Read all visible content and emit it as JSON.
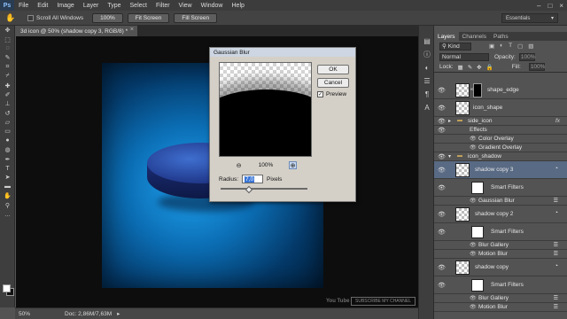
{
  "app": {
    "logo": "Ps"
  },
  "menu": [
    "File",
    "Edit",
    "Image",
    "Layer",
    "Type",
    "Select",
    "Filter",
    "View",
    "Window",
    "Help"
  ],
  "window_controls": {
    "minimize": "–",
    "maximize": "□",
    "close": "×"
  },
  "options_bar": {
    "tool_glyph": "✋",
    "scroll_all_label": "Scroll All Windows",
    "zoom_btn": "100%",
    "fit_screen_btn": "Fit Screen",
    "fill_screen_btn": "Fill Screen",
    "workspace": "Essentials"
  },
  "document": {
    "tab_title": "3d icon @ 50% (shadow copy 3, RGB/8) *",
    "close": "×"
  },
  "status": {
    "zoom": "50%",
    "doc": "Doc: 2,86M/7,63M",
    "arrow": "▸"
  },
  "watermark": {
    "brand": "You Tube",
    "subscribe": "SUBSCRIBE MY CHANNEL"
  },
  "dialog": {
    "title": "Gaussian Blur",
    "ok": "OK",
    "cancel": "Cancel",
    "preview_label": "Preview",
    "preview_checked": true,
    "zoom_out": "⊖",
    "zoom_in": "⊕",
    "zoom_level": "100%",
    "radius_label": "Radius:",
    "radius_value": "7,0",
    "radius_unit": "Pixels"
  },
  "panel": {
    "tabs": [
      "Layers",
      "Channels",
      "Paths"
    ],
    "active_tab": "Layers",
    "filter_kind": "Kind",
    "blend_mode": "Normal",
    "opacity_label": "Opacity:",
    "opacity_value": "100%",
    "lock_label": "Lock:",
    "fill_label": "Fill:",
    "fill_value": "100%",
    "layers": [
      {
        "name": "shape_edge"
      },
      {
        "name": "icon_shape"
      },
      {
        "name": "side_icon",
        "fx": "fx",
        "group": true
      },
      {
        "name": "Effects"
      },
      {
        "name": "Color Overlay"
      },
      {
        "name": "Gradient Overlay"
      },
      {
        "name": "icon_shadow",
        "group": true
      },
      {
        "name": "shadow copy 3",
        "selected": true
      },
      {
        "name": "Smart Filters"
      },
      {
        "name": "Gaussian Blur"
      },
      {
        "name": "shadow copy 2"
      },
      {
        "name": "Smart Filters"
      },
      {
        "name": "Blur Gallery"
      },
      {
        "name": "Motion Blur"
      },
      {
        "name": "shadow copy"
      },
      {
        "name": "Smart Filters"
      },
      {
        "name": "Blur Gallery"
      },
      {
        "name": "Motion Blur"
      }
    ]
  }
}
